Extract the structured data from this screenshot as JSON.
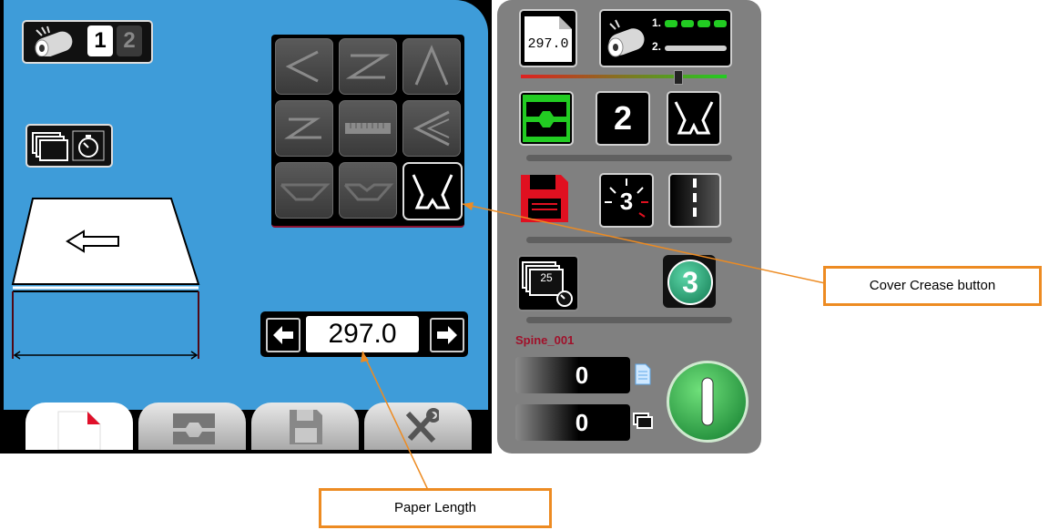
{
  "roller": {
    "btn1": "1",
    "btn2": "2"
  },
  "paper_length": {
    "value": "297.0"
  },
  "right_panel": {
    "paper_icon_value": "297.0",
    "roller_labels": [
      "1.",
      "2."
    ],
    "crease_count": "2",
    "counter_badge": "3",
    "stack_badge": "25",
    "program_number": "3",
    "job_name": "Spine_001",
    "counter_sheets": "0",
    "counter_batches": "0"
  },
  "tabs": [
    "paper",
    "crease",
    "save",
    "tools"
  ],
  "annotations": {
    "cover_crease": "Cover Crease button",
    "paper_length": "Paper Length"
  },
  "colors": {
    "panel_blue": "#3e9cd9",
    "panel_grey": "#808080",
    "accent_green": "#22cc22",
    "save_red": "#e01020",
    "callout_orange": "#ed8b22",
    "job_name_red": "#a0102a"
  },
  "icons": [
    "roller-icon",
    "stack-timer-icon",
    "paper-arrow-left-icon",
    "arrow-left-icon",
    "arrow-right-icon",
    "floppy-icon",
    "tools-icon",
    "power-icon"
  ]
}
